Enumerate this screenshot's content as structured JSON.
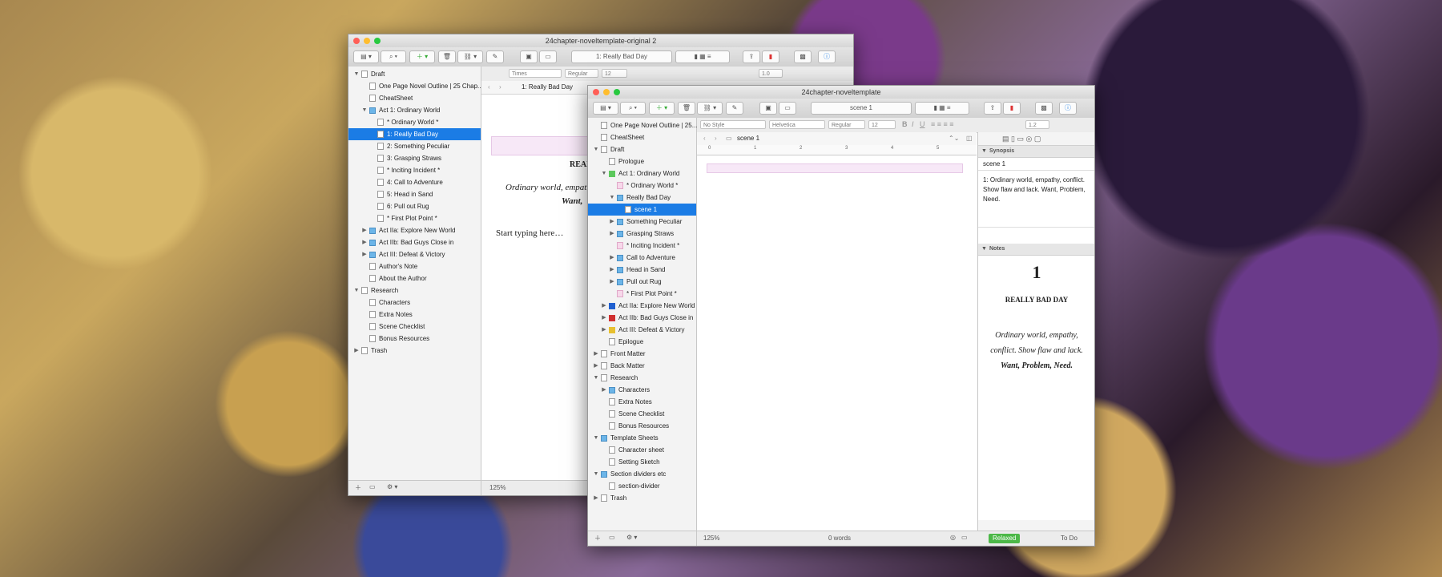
{
  "back_window": {
    "title": "24chapter-noveltemplate-original 2",
    "header_doc": "1: Really Bad Day",
    "format": {
      "font": "Times",
      "style": "Regular",
      "size": "12",
      "spacing": "1.0"
    },
    "path_title": "1: Really Bad Day",
    "binder": [
      {
        "label": "Draft",
        "depth": 0,
        "tri": "▼",
        "icon": "doc"
      },
      {
        "label": "One Page Novel Outline | 25 Chap...",
        "depth": 1,
        "icon": "doc"
      },
      {
        "label": "CheatSheet",
        "depth": 1,
        "icon": "doc"
      },
      {
        "label": "Act 1: Ordinary World",
        "depth": 1,
        "tri": "▼",
        "icon": "folder"
      },
      {
        "label": "* Ordinary World *",
        "depth": 2,
        "icon": "doc"
      },
      {
        "label": "1: Really Bad Day",
        "depth": 2,
        "icon": "doc",
        "selected": true
      },
      {
        "label": "2: Something Peculiar",
        "depth": 2,
        "icon": "doc"
      },
      {
        "label": "3: Grasping Straws",
        "depth": 2,
        "icon": "doc"
      },
      {
        "label": "* Inciting Incident *",
        "depth": 2,
        "icon": "doc"
      },
      {
        "label": "4: Call to Adventure",
        "depth": 2,
        "icon": "doc"
      },
      {
        "label": "5: Head in Sand",
        "depth": 2,
        "icon": "doc"
      },
      {
        "label": "6: Pull out Rug",
        "depth": 2,
        "icon": "doc"
      },
      {
        "label": "* First Plot Point *",
        "depth": 2,
        "icon": "doc"
      },
      {
        "label": "Act IIa: Explore New World",
        "depth": 1,
        "tri": "▶",
        "icon": "folder"
      },
      {
        "label": "Act IIb: Bad Guys Close in",
        "depth": 1,
        "tri": "▶",
        "icon": "folder"
      },
      {
        "label": "Act III: Defeat & Victory",
        "depth": 1,
        "tri": "▶",
        "icon": "folder"
      },
      {
        "label": "Author's Note",
        "depth": 1,
        "icon": "doc"
      },
      {
        "label": "About the Author",
        "depth": 1,
        "icon": "doc"
      },
      {
        "label": "Research",
        "depth": 0,
        "tri": "▼",
        "icon": "doc"
      },
      {
        "label": "Characters",
        "depth": 1,
        "icon": "doc"
      },
      {
        "label": "Extra Notes",
        "depth": 1,
        "icon": "doc"
      },
      {
        "label": "Scene Checklist",
        "depth": 1,
        "icon": "doc"
      },
      {
        "label": "Bonus Resources",
        "depth": 1,
        "icon": "doc"
      },
      {
        "label": "Trash",
        "depth": 0,
        "tri": "▶",
        "icon": "doc"
      }
    ],
    "editor": {
      "chapter_title": "REAL",
      "line1": "Ordinary world, empath",
      "line2": "Want, ",
      "typing": "Start typing here…"
    },
    "zoom": "125%"
  },
  "front_window": {
    "title": "24chapter-noveltemplate",
    "header_doc": "scene 1",
    "format": {
      "style_preset": "No Style",
      "font": "Helvetica",
      "weight": "Regular",
      "size": "12",
      "spacing": "1.2"
    },
    "path_title": "scene 1",
    "ruler_marks": [
      "0",
      "1",
      "2",
      "3",
      "4",
      "5",
      "6"
    ],
    "binder": [
      {
        "label": "One Page Novel Outline | 25...",
        "depth": 0,
        "icon": "doc"
      },
      {
        "label": "CheatSheet",
        "depth": 0,
        "icon": "doc"
      },
      {
        "label": "Draft",
        "depth": 0,
        "tri": "▼",
        "icon": "doc"
      },
      {
        "label": "Prologue",
        "depth": 1,
        "icon": "doc"
      },
      {
        "label": "Act 1: Ordinary World",
        "depth": 1,
        "tri": "▼",
        "icon": "folder",
        "color": "#5cc85c"
      },
      {
        "label": "* Ordinary World *",
        "depth": 2,
        "icon": "pink"
      },
      {
        "label": "Really Bad Day",
        "depth": 2,
        "tri": "▼",
        "icon": "folder"
      },
      {
        "label": "scene 1",
        "depth": 3,
        "icon": "doc",
        "selected": true
      },
      {
        "label": "Something Peculiar",
        "depth": 2,
        "tri": "▶",
        "icon": "folder"
      },
      {
        "label": "Grasping Straws",
        "depth": 2,
        "tri": "▶",
        "icon": "folder"
      },
      {
        "label": "* Inciting Incident *",
        "depth": 2,
        "icon": "pink"
      },
      {
        "label": "Call to Adventure",
        "depth": 2,
        "tri": "▶",
        "icon": "folder"
      },
      {
        "label": "Head in Sand",
        "depth": 2,
        "tri": "▶",
        "icon": "folder"
      },
      {
        "label": "Pull out Rug",
        "depth": 2,
        "tri": "▶",
        "icon": "folder"
      },
      {
        "label": "* First Plot Point *",
        "depth": 2,
        "icon": "pink"
      },
      {
        "label": "Act IIa: Explore New World",
        "depth": 1,
        "tri": "▶",
        "icon": "folder",
        "color": "#2060d0"
      },
      {
        "label": "Act IIb: Bad Guys Close in",
        "depth": 1,
        "tri": "▶",
        "icon": "folder",
        "color": "#d03030"
      },
      {
        "label": "Act III: Defeat & Victory",
        "depth": 1,
        "tri": "▶",
        "icon": "folder",
        "color": "#e8c030"
      },
      {
        "label": "Epilogue",
        "depth": 1,
        "icon": "doc"
      },
      {
        "label": "Front Matter",
        "depth": 0,
        "tri": "▶",
        "icon": "doc"
      },
      {
        "label": "Back Matter",
        "depth": 0,
        "tri": "▶",
        "icon": "doc"
      },
      {
        "label": "Research",
        "depth": 0,
        "tri": "▼",
        "icon": "doc"
      },
      {
        "label": "Characters",
        "depth": 1,
        "tri": "▶",
        "icon": "folder"
      },
      {
        "label": "Extra Notes",
        "depth": 1,
        "icon": "doc"
      },
      {
        "label": "Scene Checklist",
        "depth": 1,
        "icon": "doc"
      },
      {
        "label": "Bonus Resources",
        "depth": 1,
        "icon": "doc"
      },
      {
        "label": "Template Sheets",
        "depth": 0,
        "tri": "▼",
        "icon": "folder"
      },
      {
        "label": "Character sheet",
        "depth": 1,
        "icon": "doc"
      },
      {
        "label": "Setting Sketch",
        "depth": 1,
        "icon": "doc"
      },
      {
        "label": "Section dividers etc",
        "depth": 0,
        "tri": "▼",
        "icon": "folder"
      },
      {
        "label": "section-divider",
        "depth": 1,
        "icon": "doc"
      },
      {
        "label": "Trash",
        "depth": 0,
        "tri": "▶",
        "icon": "doc"
      }
    ],
    "inspector": {
      "synopsis_heading": "Synopsis",
      "synopsis_title": "scene 1",
      "synopsis_text": "1: Ordinary world, empathy, conflict. Show flaw and lack. Want, Problem, Need.",
      "notes_heading": "Notes",
      "notes_number": "1",
      "notes_title": "REALLY BAD DAY",
      "notes_body_prefix": "Ordinary world, empathy, conflict. Show flaw and lack. ",
      "notes_body_bold": "Want, Problem, Need."
    },
    "footer": {
      "zoom": "125%",
      "words": "0 words",
      "status_label": "Relaxed",
      "todo": "To Do"
    }
  },
  "colors": {
    "selection": "#1b7ce5",
    "status_green": "#4cb848",
    "light_red": "#ff5f57",
    "light_yellow": "#ffbd2e",
    "light_green": "#28c940"
  }
}
